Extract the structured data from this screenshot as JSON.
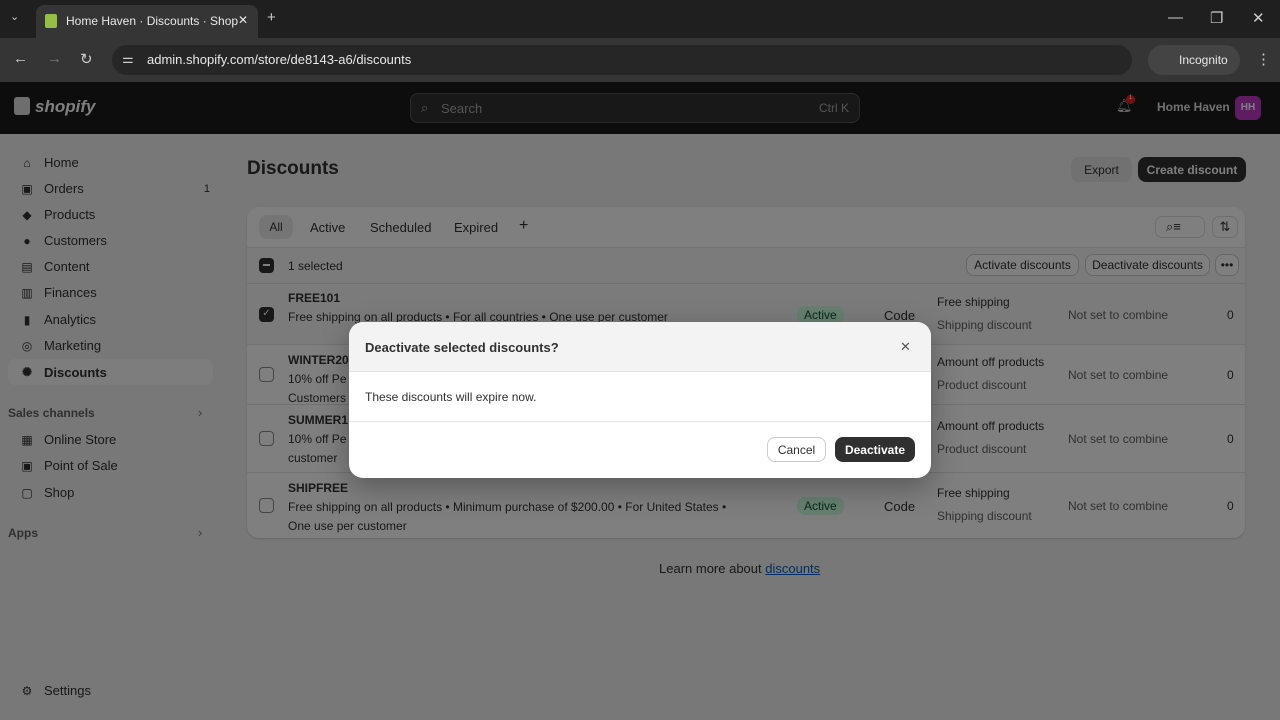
{
  "browser": {
    "tab_title": "Home Haven · Discounts · Shop",
    "url": "admin.shopify.com/store/de8143-a6/discounts",
    "incognito": "Incognito"
  },
  "header": {
    "logo": "shopify",
    "search_placeholder": "Search",
    "search_shortcut": "Ctrl K",
    "notification_count": "1",
    "store_name": "Home Haven",
    "avatar": "HH",
    "avatar_color": "#c038c6"
  },
  "sidebar": {
    "items": [
      {
        "label": "Home",
        "icon": "home-icon"
      },
      {
        "label": "Orders",
        "icon": "orders-icon",
        "count": "1"
      },
      {
        "label": "Products",
        "icon": "tag-icon"
      },
      {
        "label": "Customers",
        "icon": "person-icon"
      },
      {
        "label": "Content",
        "icon": "content-icon"
      },
      {
        "label": "Finances",
        "icon": "bank-icon"
      },
      {
        "label": "Analytics",
        "icon": "chart-icon"
      },
      {
        "label": "Marketing",
        "icon": "target-icon"
      },
      {
        "label": "Discounts",
        "icon": "discount-icon"
      }
    ],
    "sales_channels": "Sales channels",
    "channels": [
      {
        "label": "Online Store"
      },
      {
        "label": "Point of Sale"
      },
      {
        "label": "Shop"
      }
    ],
    "apps": "Apps",
    "settings": "Settings"
  },
  "page": {
    "title": "Discounts",
    "export": "Export",
    "create": "Create discount",
    "tabs": [
      "All",
      "Active",
      "Scheduled",
      "Expired"
    ],
    "selected": "1 selected",
    "activate": "Activate discounts",
    "deactivate": "Deactivate discounts",
    "rows": [
      {
        "code": "FREE101",
        "desc": "Free shipping on all products • For all countries • One use per customer",
        "desc2": "",
        "checked": true,
        "status": "Active",
        "method": "Code",
        "type": "Free shipping",
        "type2": "Shipping discount",
        "combine": "Not set to combine",
        "used": "0"
      },
      {
        "code": "WINTER20",
        "desc": "10% off Pe",
        "desc2": "Customers",
        "checked": false,
        "status": "",
        "method": "",
        "type": "Amount off products",
        "type2": "Product discount",
        "combine": "Not set to combine",
        "used": "0"
      },
      {
        "code": "SUMMER1",
        "desc": "10% off Pe",
        "desc2": "customer",
        "checked": false,
        "status": "",
        "method": "",
        "type": "Amount off products",
        "type2": "Product discount",
        "combine": "Not set to combine",
        "used": "0"
      },
      {
        "code": "SHIPFREE",
        "desc": "Free shipping on all products • Minimum purchase of $200.00 • For United States •",
        "desc2": "One use per customer",
        "checked": false,
        "status": "Active",
        "method": "Code",
        "type": "Free shipping",
        "type2": "Shipping discount",
        "combine": "Not set to combine",
        "used": "0"
      }
    ],
    "learn_more": "Learn more about",
    "learn_link": "discounts"
  },
  "modal": {
    "title": "Deactivate selected discounts?",
    "body": "These discounts will expire now.",
    "cancel": "Cancel",
    "confirm": "Deactivate"
  }
}
